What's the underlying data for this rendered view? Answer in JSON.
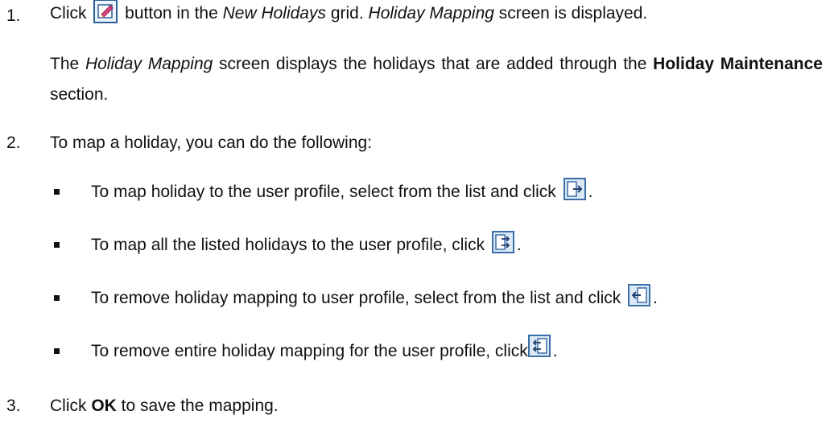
{
  "steps": [
    {
      "number": "1.",
      "before_icon": "Click",
      "icon": "edit-icon",
      "after_icon_1": " button in the ",
      "italic_1": "New Holidays",
      "after_italic_1": " grid. ",
      "italic_2": "Holiday Mapping",
      "after_italic_2": " screen is displayed.",
      "para_before": "The ",
      "para_italic": "Holiday Mapping",
      "para_middle": " screen displays the holidays that are added through the ",
      "para_bold": "Holiday Maintenance",
      "para_after": " section."
    },
    {
      "number": "2.",
      "text": "To map a holiday, you can do the following:",
      "bullets": [
        {
          "text": "To map holiday to the user profile, select from the list and click ",
          "icon": "move-right-icon",
          "end": "."
        },
        {
          "text": "To map all the listed holidays to the user profile, click ",
          "icon": "move-all-right-icon",
          "end": "."
        },
        {
          "text": "To remove holiday mapping to user profile, select from the list and click ",
          "icon": "move-left-icon",
          "end": "."
        },
        {
          "text": "To remove entire holiday mapping for the user profile, click",
          "icon": "move-all-left-icon",
          "end": "."
        }
      ]
    },
    {
      "number": "3.",
      "before_bold": "Click ",
      "bold": "OK",
      "after_bold": " to save the mapping."
    }
  ],
  "colors": {
    "icon_border": "#3c6ea8",
    "icon_fill": "#dce9f7",
    "text": "#111111"
  }
}
